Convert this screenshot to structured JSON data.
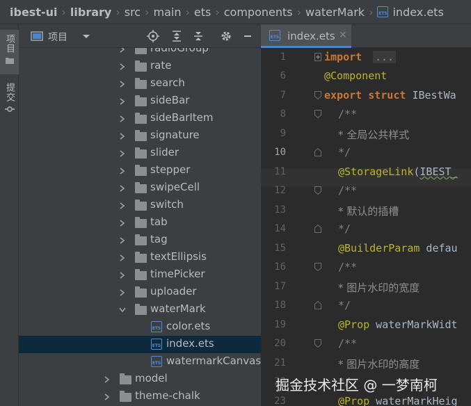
{
  "breadcrumb": {
    "items": [
      "ibest-ui",
      "library",
      "src",
      "main",
      "ets",
      "components",
      "waterMark",
      "index.ets"
    ]
  },
  "toolstrip": {
    "project_label": "项目",
    "commit_label": "提交"
  },
  "project_panel": {
    "title": "项目",
    "tree": [
      {
        "label": "radioGroup",
        "type": "folder",
        "expanded": false
      },
      {
        "label": "rate",
        "type": "folder",
        "expanded": false
      },
      {
        "label": "search",
        "type": "folder",
        "expanded": false
      },
      {
        "label": "sideBar",
        "type": "folder",
        "expanded": false
      },
      {
        "label": "sideBarItem",
        "type": "folder",
        "expanded": false
      },
      {
        "label": "signature",
        "type": "folder",
        "expanded": false
      },
      {
        "label": "slider",
        "type": "folder",
        "expanded": false
      },
      {
        "label": "stepper",
        "type": "folder",
        "expanded": false
      },
      {
        "label": "swipeCell",
        "type": "folder",
        "expanded": false
      },
      {
        "label": "switch",
        "type": "folder",
        "expanded": false
      },
      {
        "label": "tab",
        "type": "folder",
        "expanded": false
      },
      {
        "label": "tag",
        "type": "folder",
        "expanded": false
      },
      {
        "label": "textEllipsis",
        "type": "folder",
        "expanded": false
      },
      {
        "label": "timePicker",
        "type": "folder",
        "expanded": false
      },
      {
        "label": "uploader",
        "type": "folder",
        "expanded": false
      },
      {
        "label": "waterMark",
        "type": "folder",
        "expanded": true
      },
      {
        "label": "color.ets",
        "type": "file"
      },
      {
        "label": "index.ets",
        "type": "file",
        "selected": true
      },
      {
        "label": "watermarkCanvas.e",
        "type": "file"
      },
      {
        "label": "model",
        "type": "folder",
        "expanded": false
      },
      {
        "label": "theme-chalk",
        "type": "folder",
        "expanded": false
      }
    ]
  },
  "editor": {
    "tab_label": "index.ets",
    "tab_close": "×",
    "current_line": "10",
    "lines": [
      {
        "num": "1",
        "text": "import"
      },
      {
        "num": "6",
        "text": "@Component"
      },
      {
        "num": "7",
        "text": "export struct IBestWa"
      },
      {
        "num": "8",
        "text": "/**"
      },
      {
        "num": "9",
        "text": " * 全局公共样式"
      },
      {
        "num": "10",
        "text": " */"
      },
      {
        "num": "11",
        "text": "@StorageLink(IBEST_"
      },
      {
        "num": "12",
        "text": "/**"
      },
      {
        "num": "13",
        "text": " * 默认的插槽"
      },
      {
        "num": "14",
        "text": " */"
      },
      {
        "num": "15",
        "text": "@BuilderParam defau"
      },
      {
        "num": "16",
        "text": "/**"
      },
      {
        "num": "17",
        "text": " * 图片水印的宽度"
      },
      {
        "num": "18",
        "text": " */"
      },
      {
        "num": "19",
        "text": "@Prop waterMarkWidt"
      },
      {
        "num": "20",
        "text": "/**"
      },
      {
        "num": "21",
        "text": " * 图片水印的高度"
      },
      {
        "num": "22",
        "text": " */"
      },
      {
        "num": "23",
        "text": "@Prop waterMarkHeig"
      }
    ],
    "fold_placeholder": "..."
  },
  "watermark_text": "掘金技术社区 @ 一梦南柯",
  "colors": {
    "keyword": "#cc7832",
    "annotation": "#bbb529",
    "comment": "#808080",
    "selection": "#0d293e",
    "accent": "#4a88c7"
  }
}
